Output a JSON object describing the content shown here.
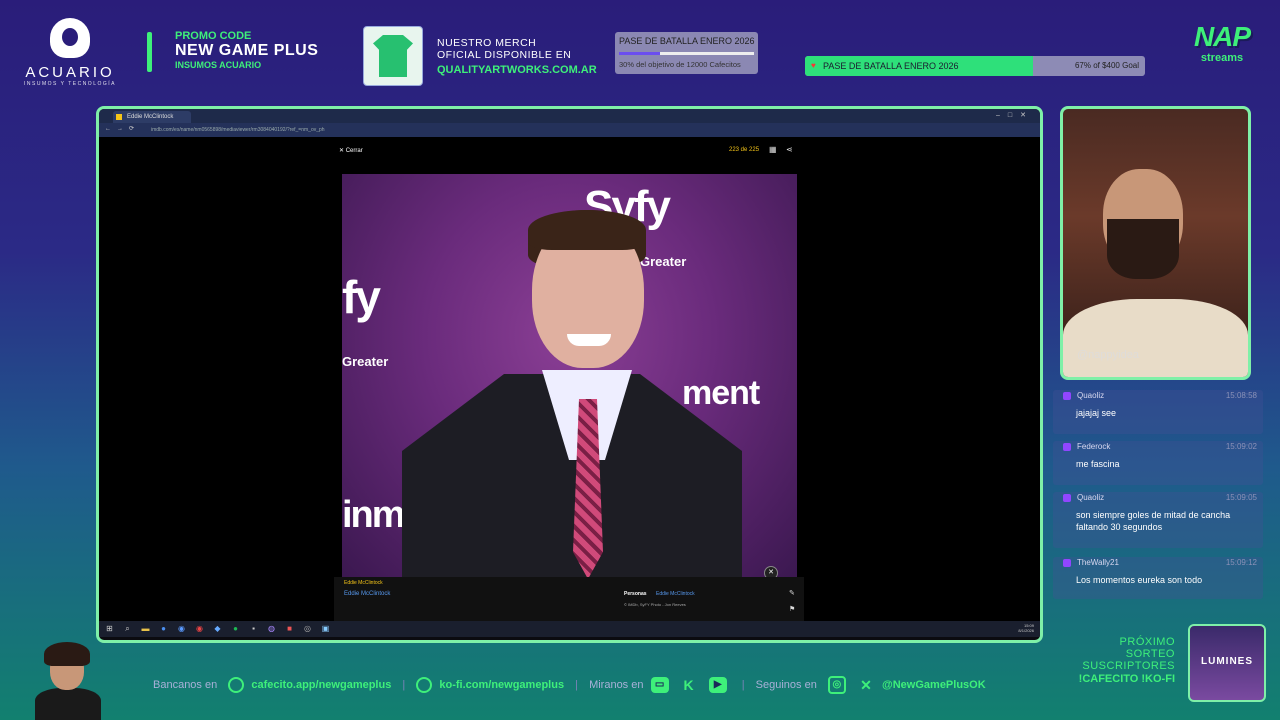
{
  "header": {
    "logo": {
      "name": "ACUARIO",
      "sub": "INSUMOS Y TECNOLOGÍA"
    },
    "promo": {
      "line1": "PROMO CODE",
      "line2": "NEW GAME PLUS",
      "line3": "INSUMOS ACUARIO"
    },
    "merch": {
      "line1": "NUESTRO MERCH",
      "line2": "OFICIAL DISPONIBLE EN",
      "line3": "QUALITYARTWORKS.COM.AR"
    },
    "goal_small": {
      "title": "PASE DE BATALLA ENERO 2026",
      "progress": 0.3,
      "sub": "30% del objetivo de 12000 Cafecitos"
    },
    "goal_wide": {
      "title": "PASE DE BATALLA ENERO 2026",
      "progress": 0.67,
      "right": "67% of $400 Goal"
    },
    "brand": {
      "big": "NAP",
      "small": "streams"
    }
  },
  "browser": {
    "tab_title": "Eddie McClintock",
    "url": "imdb.com/es/name/nm0565898/mediaviewer/rm3084040192/?ref_=nm_ov_ph",
    "close_label": "Cerrar",
    "counter": "223 de 225",
    "photo_text": {
      "brand": "Syfy",
      "greater": "Greater",
      "brand2": "fy",
      "ment": "ment",
      "inme": "inme"
    },
    "caption": {
      "small_title": "Eddie McClintock",
      "name_link": "Eddie McClintock",
      "people_label": "Personas",
      "people_value": "Eddie McClintock",
      "credit": "© IMDb, SyFY Photo - Jon Reeves"
    },
    "clock": {
      "time": "15:09",
      "date": "8/1/2026"
    }
  },
  "cam": {
    "tag": "@nappyidea"
  },
  "chat": [
    {
      "user": "Quaoliz",
      "time": "15:08:58",
      "msg": "jajajaj see"
    },
    {
      "user": "Federock",
      "time": "15:09:02",
      "msg": "me fascina"
    },
    {
      "user": "Quaoliz",
      "time": "15:09:05",
      "msg": "son siempre goles de mitad de cancha faltando 30 segundos"
    },
    {
      "user": "TheWally21",
      "time": "15:09:12",
      "msg": "Los momentos eureka son todo"
    }
  ],
  "footer": {
    "bancanos_label": "Bancanos en",
    "cafecito": "cafecito.app/newgameplus",
    "kofi": "ko-fi.com/newgameplus",
    "miranos_label": "Miranos en",
    "seguinos_label": "Seguinos en",
    "social": "@NewGamePlusOK",
    "sep": "|"
  },
  "sorteo": {
    "l1": "PRÓXIMO",
    "l2": "SORTEO",
    "l3": "SUSCRIPTORES",
    "l4": "!CAFECITO !KO-FI",
    "game": "LUMINES"
  },
  "colors": {
    "accent": "#3ef07a",
    "imdb_yellow": "#f5c518",
    "link_blue": "#5799ef"
  }
}
